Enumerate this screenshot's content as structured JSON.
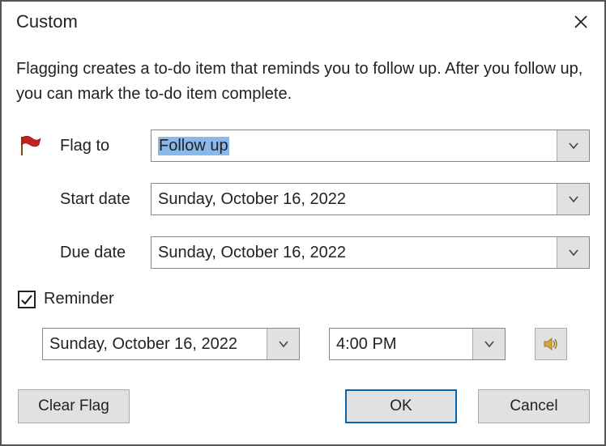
{
  "title": "Custom",
  "description": "Flagging creates a to-do item that reminds you to follow up. After you follow up, you can mark the to-do item complete.",
  "flag_to": {
    "label": "Flag to",
    "value": "Follow up"
  },
  "start_date": {
    "label": "Start date",
    "value": "Sunday, October 16, 2022"
  },
  "due_date": {
    "label": "Due date",
    "value": "Sunday, October 16, 2022"
  },
  "reminder": {
    "label": "Reminder",
    "checked": true,
    "date": "Sunday, October 16, 2022",
    "time": "4:00 PM"
  },
  "buttons": {
    "clear_flag": "Clear Flag",
    "ok": "OK",
    "cancel": "Cancel"
  }
}
